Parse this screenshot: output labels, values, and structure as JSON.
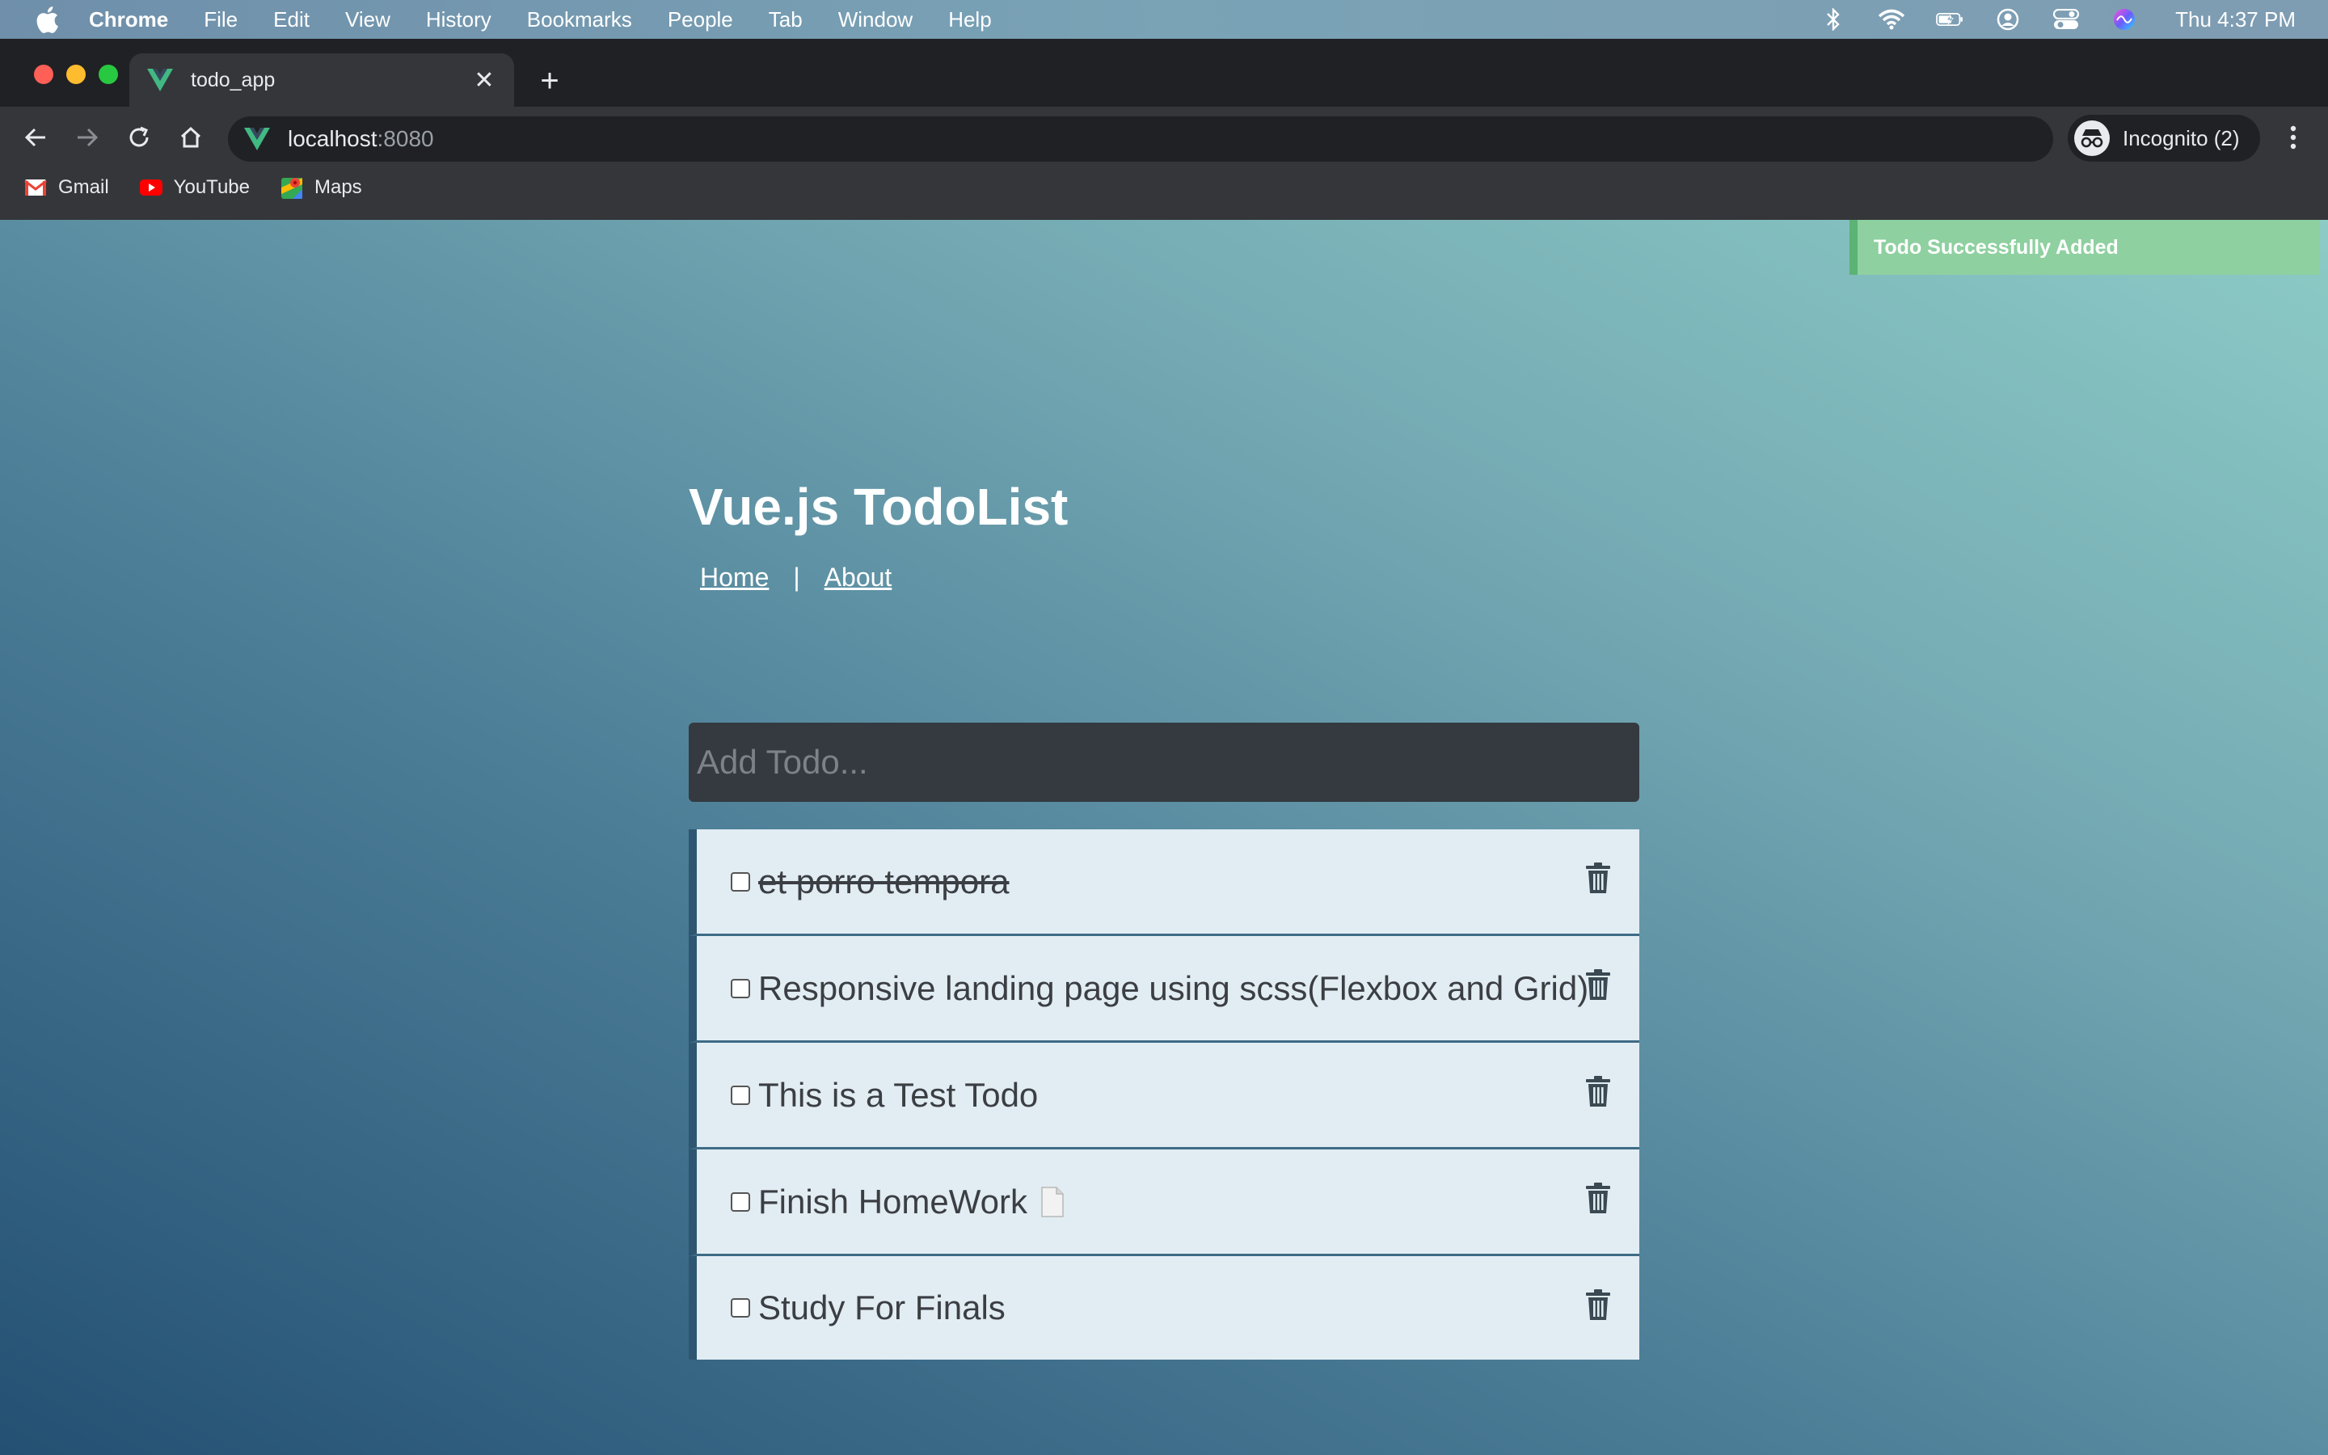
{
  "menubar": {
    "app_name": "Chrome",
    "items": [
      "File",
      "Edit",
      "View",
      "History",
      "Bookmarks",
      "People",
      "Tab",
      "Window",
      "Help"
    ],
    "clock": "Thu 4:37 PM",
    "status_icons": [
      "bluetooth-icon",
      "wifi-icon",
      "battery-icon",
      "user-icon",
      "control-center-icon",
      "siri-icon"
    ]
  },
  "browser": {
    "tab_title": "todo_app",
    "url_host": "localhost",
    "url_port": ":8080",
    "incognito_label": "Incognito (2)",
    "bookmarks": [
      "Gmail",
      "YouTube",
      "Maps"
    ]
  },
  "page": {
    "toast": "Todo Successfully Added",
    "title": "Vue.js TodoList",
    "nav": {
      "home": "Home",
      "separator": "|",
      "about": "About"
    },
    "add_placeholder": "Add Todo...",
    "todos": [
      {
        "text": "et porro tempora",
        "completed": true
      },
      {
        "text": "Responsive landing page using scss(Flexbox and Grid)",
        "completed": false
      },
      {
        "text": "This is a Test Todo",
        "completed": false
      },
      {
        "text": "Finish HomeWork",
        "completed": false
      },
      {
        "text": "Study For Finals",
        "completed": false
      }
    ]
  },
  "colors": {
    "toast_bg": "#8ed0a0",
    "todo_bg": "#e2edf3",
    "input_bg": "#343a40",
    "vue_green": "#42b883"
  }
}
